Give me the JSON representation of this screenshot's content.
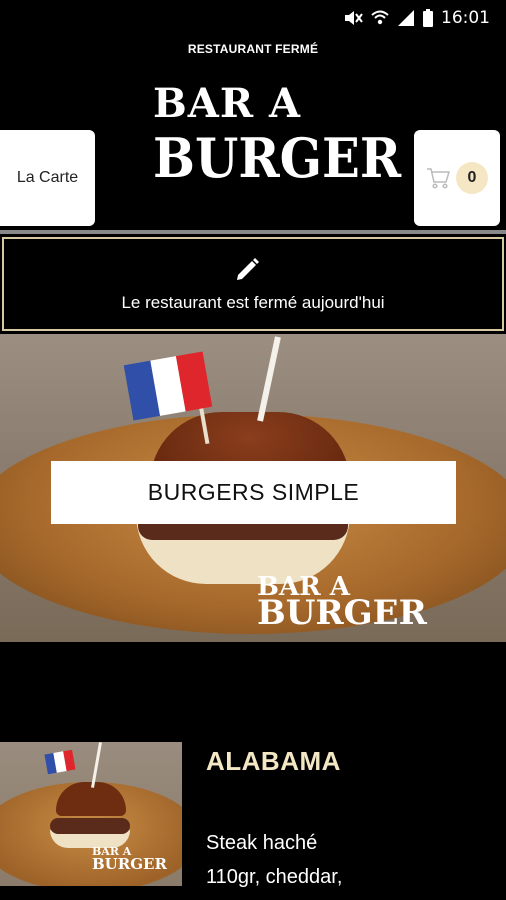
{
  "status_bar": {
    "time": "16:01",
    "icons": [
      "mute-icon",
      "wifi-icon",
      "signal-icon",
      "battery-icon"
    ]
  },
  "header": {
    "closed_label": "RESTAURANT FERMÉ",
    "logo": {
      "line1": "BAR A",
      "line2": "BURGER"
    },
    "carte_label": "La Carte",
    "cart": {
      "icon": "cart-icon",
      "count": "0"
    }
  },
  "notice": {
    "icon": "pencil-icon",
    "text": "Le restaurant est fermé aujourd'hui"
  },
  "hero": {
    "category_label": "BURGERS SIMPLE",
    "watermark": {
      "line1": "BAR A",
      "line2": "BURGER"
    }
  },
  "product": {
    "name": "ALABAMA",
    "description": "Steak haché 110gr, cheddar,",
    "thumb_watermark": {
      "line1": "BAR A",
      "line2": "BURGER"
    }
  },
  "colors": {
    "background": "#000000",
    "accent_cream": "#f3e7c4",
    "cart_badge": "#f5e6c4",
    "notice_border": "#d9c9a3"
  }
}
